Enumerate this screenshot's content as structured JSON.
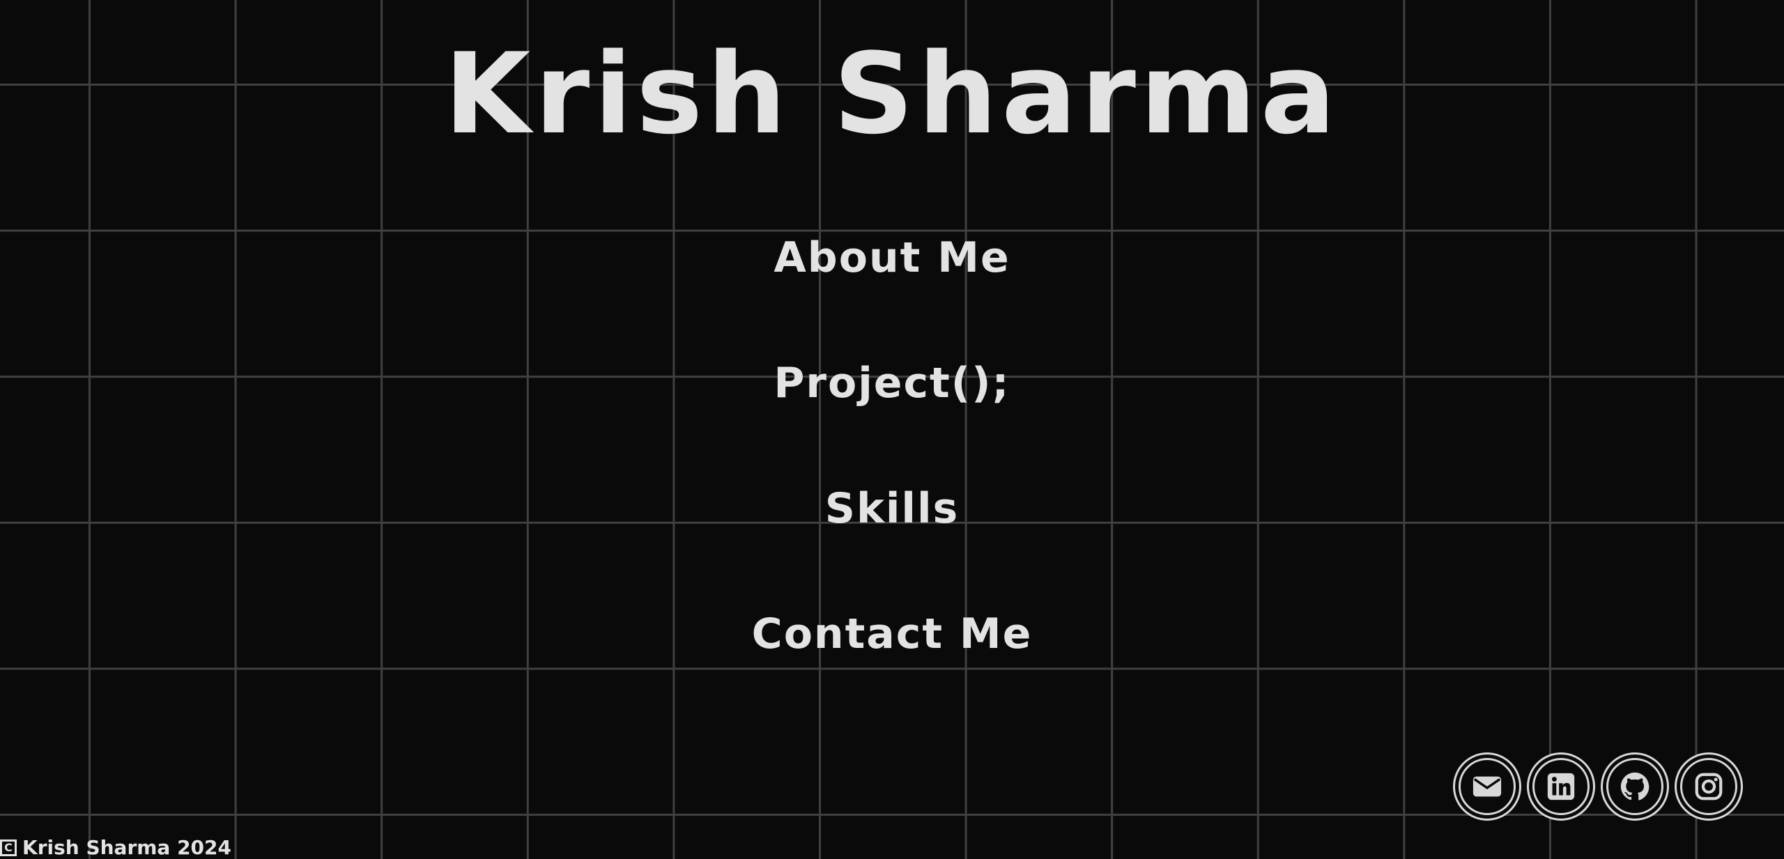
{
  "header": {
    "title": "Krish Sharma"
  },
  "nav": {
    "items": [
      {
        "label": "About Me"
      },
      {
        "label": "Project();"
      },
      {
        "label": "Skills"
      },
      {
        "label": "Contact Me"
      }
    ]
  },
  "socials": [
    {
      "name": "email",
      "icon": "envelope-icon"
    },
    {
      "name": "linkedin",
      "icon": "linkedin-icon"
    },
    {
      "name": "github",
      "icon": "github-icon"
    },
    {
      "name": "instagram",
      "icon": "instagram-icon"
    }
  ],
  "footer": {
    "copyright_symbol": "C",
    "text": "Krish Sharma 2024"
  },
  "colors": {
    "background": "#0a0a0a",
    "grid": "#404040",
    "text": "#e3e3e3"
  }
}
